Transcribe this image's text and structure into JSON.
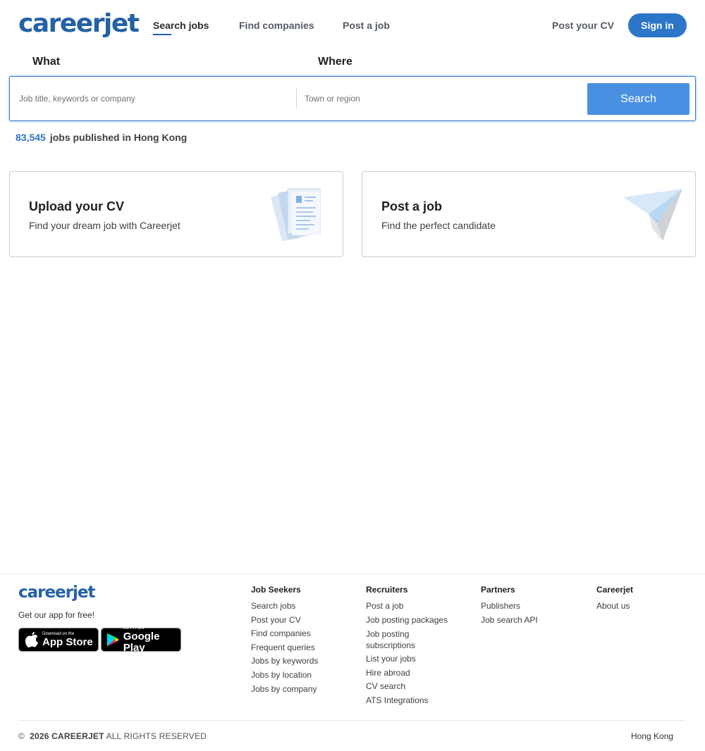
{
  "header": {
    "logo": "careerjet",
    "nav": [
      "Search jobs",
      "Find companies",
      "Post a job"
    ],
    "post_cv": "Post your CV",
    "sign_in": "Sign in"
  },
  "search": {
    "what_label": "What",
    "where_label": "Where",
    "what_placeholder": "Job title, keywords or company",
    "where_placeholder": "Town or region",
    "button": "Search"
  },
  "jobs_count": {
    "number": "83,545",
    "text": "jobs published in Hong Kong"
  },
  "cards": [
    {
      "title": "Upload your CV",
      "subtitle": "Find your dream job with Careerjet",
      "icon": "cv-document-icon"
    },
    {
      "title": "Post a job",
      "subtitle": "Find the perfect candidate",
      "icon": "paper-plane-icon"
    }
  ],
  "footer": {
    "logo": "careerjet",
    "app_text": "Get our app for free!",
    "app_store": {
      "small": "Download on the",
      "big": "App Store"
    },
    "google_play": {
      "small": "GET IT ON",
      "big": "Google Play"
    },
    "columns": [
      {
        "title": "Job Seekers",
        "links": [
          "Search jobs",
          "Post your CV",
          "Find companies",
          "Frequent queries",
          "Jobs by keywords",
          "Jobs by location",
          "Jobs by company"
        ]
      },
      {
        "title": "Recruiters",
        "links": [
          "Post a job",
          "Job posting packages",
          "Job posting subscriptions",
          "List your jobs",
          "Hire abroad",
          "CV search",
          "ATS Integrations"
        ]
      },
      {
        "title": "Partners",
        "links": [
          "Publishers",
          "Job search API"
        ]
      },
      {
        "title": "Careerjet",
        "links": [
          "About us"
        ]
      }
    ],
    "copyright_symbol": "©",
    "copyright_year_brand": "2026 CAREERJET",
    "copyright_rest": "ALL RIGHTS RESERVED",
    "country": "Hong Kong"
  },
  "colors": {
    "brand": "#2461a6",
    "accent": "#2c75c9",
    "search_button": "#4a90e2"
  }
}
